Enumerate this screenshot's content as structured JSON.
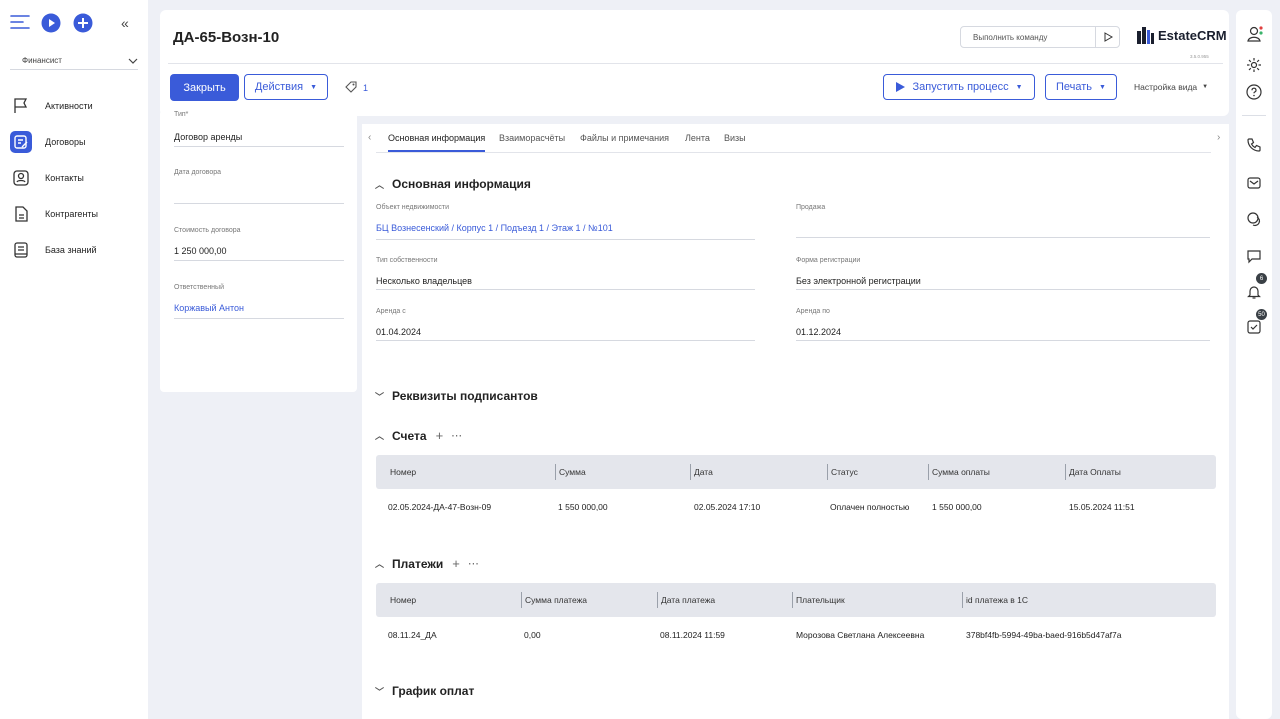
{
  "sidebar": {
    "role": "Финансист",
    "items": [
      {
        "label": "Активности",
        "icon": "flag-icon"
      },
      {
        "label": "Договоры",
        "icon": "contract-icon",
        "active": true
      },
      {
        "label": "Контакты",
        "icon": "contact-icon"
      },
      {
        "label": "Контрагенты",
        "icon": "document-icon"
      },
      {
        "label": "База знаний",
        "icon": "book-icon"
      }
    ]
  },
  "header": {
    "title": "ДА-65-Возн-10",
    "command_placeholder": "Выполнить команду",
    "brand": "EstateCRM",
    "version": "3.5.0.955",
    "close_label": "Закрыть",
    "actions_label": "Действия",
    "tag_count": "1",
    "run_process_label": "Запустить процесс",
    "print_label": "Печать",
    "view_settings_label": "Настройка вида"
  },
  "left_panel": {
    "type_label": "Тип*",
    "type_value": "Договор аренды",
    "date_label": "Дата договора",
    "date_value": "",
    "cost_label": "Стоимость договора",
    "cost_value": "1 250 000,00",
    "responsible_label": "Ответственный",
    "responsible_value": "Коржавый Антон"
  },
  "tabs": [
    "Основная информация",
    "Взаиморасчёты",
    "Файлы и примечания",
    "Лента",
    "Визы"
  ],
  "main_info": {
    "title": "Основная информация",
    "object_label": "Объект недвижимости",
    "object_value": "БЦ Вознесенский / Корпус 1 / Подъезд 1 / Этаж 1 / №101",
    "sale_label": "Продажа",
    "sale_value": "",
    "ownership_label": "Тип собственности",
    "ownership_value": "Несколько владельцев",
    "registration_label": "Форма регистрации",
    "registration_value": "Без электронной регистрации",
    "rent_from_label": "Аренда с",
    "rent_from_value": "01.04.2024",
    "rent_to_label": "Аренда по",
    "rent_to_value": "01.12.2024"
  },
  "signers": {
    "title": "Реквизиты подписантов"
  },
  "invoices": {
    "title": "Счета",
    "columns": [
      "Номер",
      "Сумма",
      "Дата",
      "Статус",
      "Сумма оплаты",
      "Дата Оплаты"
    ],
    "rows": [
      [
        "02.05.2024-ДА-47-Возн-09",
        "1 550 000,00",
        "02.05.2024 17:10",
        "Оплачен полностью",
        "1 550 000,00",
        "15.05.2024 11:51"
      ]
    ]
  },
  "payments": {
    "title": "Платежи",
    "columns": [
      "Номер",
      "Сумма платежа",
      "Дата платежа",
      "Плательщик",
      "id платежа в 1С"
    ],
    "rows": [
      [
        "08.11.24_ДА",
        "0,00",
        "08.11.2024 11:59",
        "Морозова Светлана Алексеевна",
        "378bf4fb-5994-49ba-baed-916b5d47af7a"
      ]
    ]
  },
  "schedule": {
    "title": "График оплат"
  },
  "right_bar": {
    "notifications_count": "6",
    "tasks_count": "50"
  },
  "colors": {
    "accent": "#3a5bd9",
    "background": "#eef0f6"
  }
}
